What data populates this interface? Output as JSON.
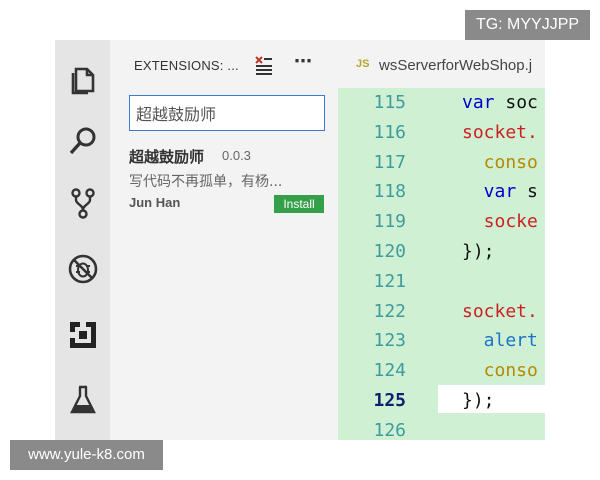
{
  "overlay": {
    "tg_badge": "TG: MYYJJPP",
    "watermark": "www.yule-k8.com"
  },
  "activity_bar": {
    "items": [
      {
        "name": "explorer",
        "icon": "files-icon"
      },
      {
        "name": "search",
        "icon": "search-icon"
      },
      {
        "name": "source-control",
        "icon": "git-branch-icon"
      },
      {
        "name": "debug",
        "icon": "no-bug-icon"
      },
      {
        "name": "extensions",
        "icon": "extensions-icon"
      },
      {
        "name": "test",
        "icon": "flask-icon"
      }
    ]
  },
  "sidebar": {
    "title": "EXTENSIONS: ...",
    "search": {
      "value": "超越鼓励师",
      "placeholder": ""
    },
    "extension": {
      "name": "超越鼓励师",
      "version": "0.0.3",
      "description": "写代码不再孤单，有杨...",
      "author": "Jun Han",
      "install_label": "Install"
    }
  },
  "editor": {
    "tab": {
      "icon_label": "JS",
      "filename": "wsServerforWebShop.j"
    },
    "active_line": "125",
    "lines": [
      {
        "num": "115",
        "code": [
          {
            "t": "var ",
            "c": "#0000cc"
          },
          {
            "t": "soc",
            "c": "#111111"
          }
        ]
      },
      {
        "num": "116",
        "code": [
          {
            "t": "socket.",
            "c": "#cc2222"
          }
        ]
      },
      {
        "num": "117",
        "code": [
          {
            "t": "  conso",
            "c": "#b58900"
          }
        ]
      },
      {
        "num": "118",
        "code": [
          {
            "t": "  var ",
            "c": "#0000cc"
          },
          {
            "t": "s",
            "c": "#111111"
          }
        ]
      },
      {
        "num": "119",
        "code": [
          {
            "t": "  socke",
            "c": "#cc2222"
          }
        ]
      },
      {
        "num": "120",
        "code": [
          {
            "t": "});",
            "c": "#111111"
          }
        ]
      },
      {
        "num": "121",
        "code": []
      },
      {
        "num": "122",
        "code": [
          {
            "t": "socket.",
            "c": "#cc2222"
          }
        ]
      },
      {
        "num": "123",
        "code": [
          {
            "t": "  alert",
            "c": "#1a73c8"
          }
        ]
      },
      {
        "num": "124",
        "code": [
          {
            "t": "  conso",
            "c": "#b58900"
          }
        ]
      },
      {
        "num": "125",
        "code": [
          {
            "t": "});",
            "c": "#111111"
          }
        ]
      },
      {
        "num": "126",
        "code": []
      }
    ]
  }
}
